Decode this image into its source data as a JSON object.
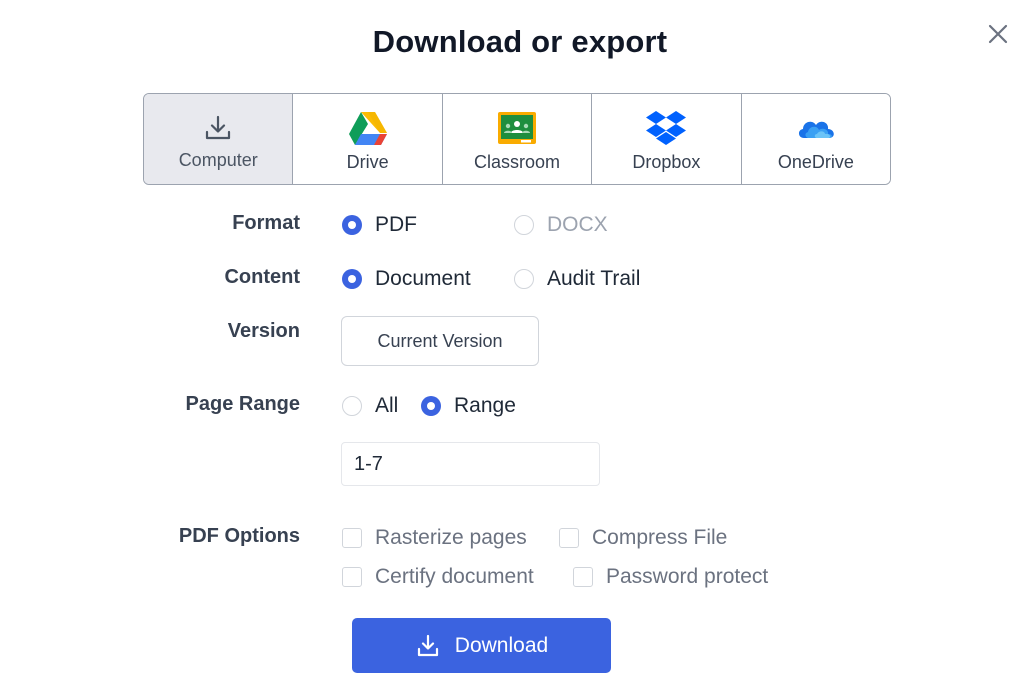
{
  "dialog": {
    "title": "Download or export"
  },
  "destinations": [
    {
      "label": "Computer",
      "icon": "download-icon",
      "selected": true
    },
    {
      "label": "Drive",
      "icon": "google-drive-icon",
      "selected": false
    },
    {
      "label": "Classroom",
      "icon": "google-classroom-icon",
      "selected": false
    },
    {
      "label": "Dropbox",
      "icon": "dropbox-icon",
      "selected": false
    },
    {
      "label": "OneDrive",
      "icon": "onedrive-icon",
      "selected": false
    }
  ],
  "format": {
    "label": "Format",
    "options": [
      {
        "label": "PDF",
        "checked": true
      },
      {
        "label": "DOCX",
        "checked": false,
        "disabled": true
      }
    ]
  },
  "content": {
    "label": "Content",
    "options": [
      {
        "label": "Document",
        "checked": true
      },
      {
        "label": "Audit Trail",
        "checked": false
      }
    ]
  },
  "version": {
    "label": "Version",
    "value": "Current Version"
  },
  "page_range": {
    "label": "Page Range",
    "options": [
      {
        "label": "All",
        "checked": false
      },
      {
        "label": "Range",
        "checked": true
      }
    ],
    "range_value": "1-7"
  },
  "pdf_options": {
    "label": "PDF Options",
    "items": [
      {
        "label": "Rasterize pages",
        "checked": false
      },
      {
        "label": "Compress File",
        "checked": false
      },
      {
        "label": "Certify document",
        "checked": false
      },
      {
        "label": "Password protect",
        "checked": false
      }
    ]
  },
  "download_button": {
    "label": "Download"
  },
  "colors": {
    "accent": "#3b63e0",
    "selected_tab_bg": "#e8e9ee",
    "border": "#9ca3af"
  }
}
